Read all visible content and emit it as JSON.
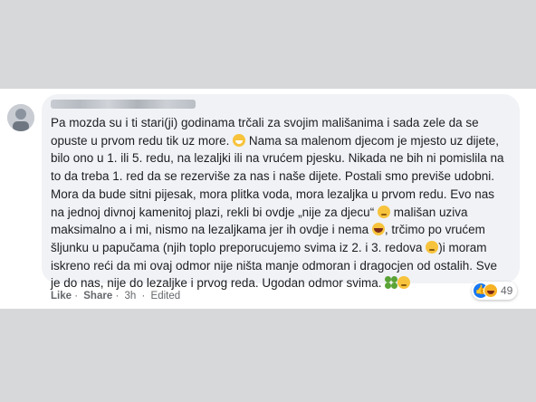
{
  "comment": {
    "author_name": "",
    "lines": [
      "Pa mozda su i ti stari(ji) godinama trčali za svojim mališanima i sada zele da se",
      "opuste u prvom redu tik uz more.",
      " Nama sa malenom djecom je mjesto uz dijete,",
      "bilo ono u 1. ili 5. redu, na lezaljki ili na vrućem pjesku. Nikada ne bih ni pomislila na",
      "to da treba 1. red da se rezerviše za nas i naše dijete. Postali smo previše udobni.",
      "Mora da bude sitni pijesak, mora plitka voda, mora lezaljka u prvom redu. Evo nas",
      "na jednoj divnoj kamenitoj plazi, rekli bi ovdje „nije za djecu“",
      " mališan uziva",
      "maksimalno a i mi, nismo na lezaljkama jer ih ovdje i nema",
      ", trčimo po vrućem",
      "šljunku u papučama (njih toplo preporucujemo svima iz 2. i 3. redova",
      ")i moram",
      "iskreno reći da mi ovaj odmor nije ništa manje odmoran i dragocjen od ostalih. Sve",
      "je do nas, nije do lezaljke i prvog reda. Ugodan odmor svima."
    ],
    "emojis": [
      "grin-emoji",
      "wink-emoji",
      "laughing-emoji",
      "wink-emoji",
      "four-leaf-clover-emoji",
      "relieved-emoji"
    ]
  },
  "actions": {
    "like": "Like",
    "sep1": "·",
    "share": "Share",
    "sep2": "·",
    "time": "3h",
    "sep3": "·",
    "edited": "Edited"
  },
  "reactions": {
    "types": [
      "like-icon",
      "haha-icon"
    ],
    "count": "49"
  },
  "colors": {
    "bubble": "#f0f2f5",
    "text": "#1c1e21",
    "meta": "#65676b",
    "like": "#1877f2"
  }
}
